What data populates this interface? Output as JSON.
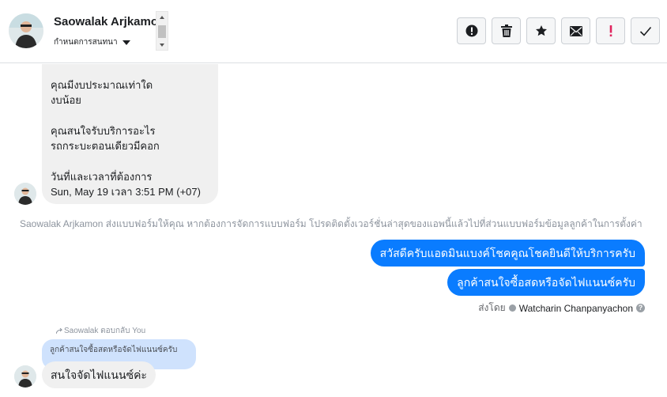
{
  "header": {
    "contact_name": "Saowalak Arjkamon",
    "status_label": "กำหนดการสนทนา",
    "toolbar": [
      {
        "name": "report-spam-button",
        "icon": "exclamation-circle-icon"
      },
      {
        "name": "delete-button",
        "icon": "trash-icon"
      },
      {
        "name": "star-button",
        "icon": "star-icon"
      },
      {
        "name": "mark-unread-button",
        "icon": "envelope-icon"
      },
      {
        "name": "follow-up-button",
        "icon": "red-exclamation-icon"
      },
      {
        "name": "mark-done-button",
        "icon": "checkmark-icon"
      }
    ]
  },
  "messages": {
    "form_lines": [
      "คุณมีงบประมาณเท่าใด",
      "งบน้อย",
      "คุณสนใจรับบริการอะไร",
      "รถกระบะตอนเดียวมีคอก",
      "วันที่และเวลาที่ต้องการ",
      "Sun, May 19 เวลา 3:51 PM (+07)"
    ],
    "system_note": "Saowalak Arjkamon ส่งแบบฟอร์มให้คุณ หากต้องการจัดการแบบฟอร์ม โปรดติดตั้งเวอร์ชั่นล่าสุดของแอพนี้แล้วไปที่ส่วนแบบฟอร์มข้อมูลลูกค้าในการตั้งค่า",
    "outgoing": [
      "สวัสดีครับแอดมินแบงค์โชคคูณโชคยินดีให้บริการครับ",
      "ลูกค้าสนใจซื้อสดหรือจัดไฟแนนซ์ครับ"
    ],
    "sent_by_label": "ส่งโดย",
    "sent_by_agent": "Watcharin Chanpanyachon",
    "help_glyph": "?",
    "reply_label": "Saowalak ตอบกลับ You",
    "quoted_text": "ลูกค้าสนใจซื้อสดหรือจัดไฟแนนซ์ครับ",
    "incoming_reply": "สนใจจัดไฟแนนซ์ค่ะ"
  },
  "colors": {
    "outgoing_bubble": "#0a7cff",
    "incoming_bubble": "#f0f0f0",
    "quoted_bubble": "#cfe2fd",
    "alert_red": "#e0245e"
  }
}
